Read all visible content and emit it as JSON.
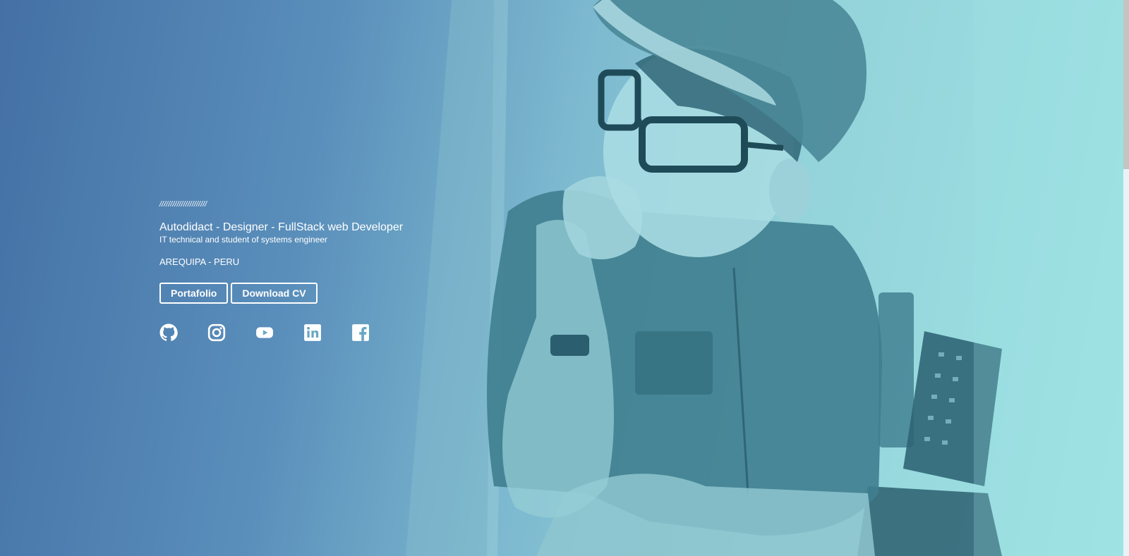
{
  "hero": {
    "decoration": "//////////////////////",
    "role": "Autodidact - Designer - FullStack web Developer",
    "subtitle": "IT technical and student of systems engineer",
    "location": "AREQUIPA - PERU"
  },
  "buttons": {
    "portfolio": "Portafolio",
    "cv": "Download CV"
  },
  "socials": [
    {
      "icon": "github-icon"
    },
    {
      "icon": "instagram-icon"
    },
    {
      "icon": "youtube-icon"
    },
    {
      "icon": "linkedin-icon"
    },
    {
      "icon": "facebook-icon"
    }
  ],
  "colors": {
    "gradient_start": "#4470a5",
    "gradient_end": "#9fe3e4",
    "text": "#ffffff"
  }
}
